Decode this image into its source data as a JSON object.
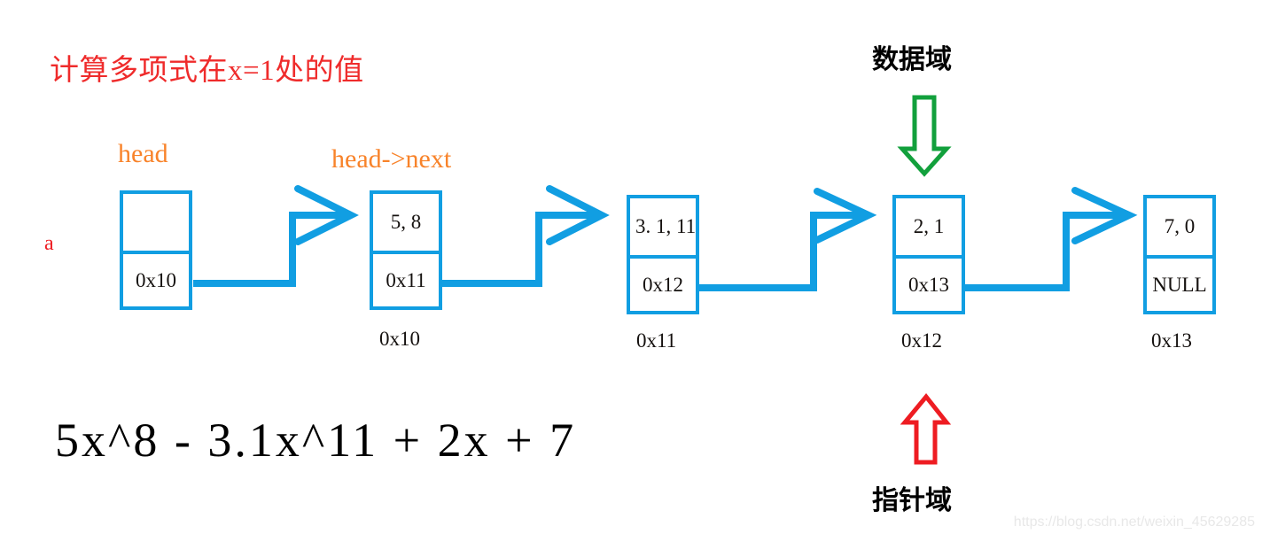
{
  "title": "计算多项式在x=1处的值",
  "variable_label": "a",
  "pointer_labels": {
    "head": "head",
    "head_next": "head->next"
  },
  "annotations": {
    "data_field": "数据域",
    "pointer_field": "指针域"
  },
  "polynomial": "5x^8 - 3.1x^11 + 2x + 7",
  "watermark": "https://blog.csdn.net/weixin_45629285",
  "colors": {
    "node_border": "#119ee2",
    "link": "#119ee2",
    "title_red": "#ef2b2b",
    "pointer_orange": "#f8832a",
    "data_arrow_green": "#12a03c",
    "pointer_arrow_red": "#ee1c22"
  },
  "nodes": [
    {
      "data": "",
      "next": "0x10",
      "address": ""
    },
    {
      "data": "5, 8",
      "next": "0x11",
      "address": "0x10"
    },
    {
      "data": "3. 1, 11",
      "next": "0x12",
      "address": "0x11"
    },
    {
      "data": "2, 1",
      "next": "0x13",
      "address": "0x12"
    },
    {
      "data": "7, 0",
      "next": "NULL",
      "address": "0x13"
    }
  ]
}
